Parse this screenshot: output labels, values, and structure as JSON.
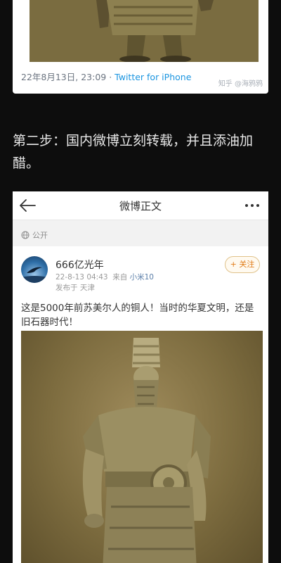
{
  "tweet": {
    "timestamp": "22年8月13日, 23:09",
    "separator": " · ",
    "source": "Twitter for iPhone",
    "watermark": "知乎 @海鸦鸦"
  },
  "narration": {
    "text": "第二步：国内微博立刻转载，并且添油加醋。"
  },
  "weibo": {
    "nav_title": "微博正文",
    "privacy_label": "公开",
    "post": {
      "username": "666亿光年",
      "date": "22-8-13 04:43",
      "source_prefix": "来自",
      "device": "小米10",
      "location": "发布于 天津",
      "follow_label": "+ 关注",
      "text": "这是5000年前苏美尔人的铜人！当时的华夏文明，还是旧石器时代！"
    }
  },
  "colors": {
    "page_bg": "#0d0d0d",
    "twitter_link": "#1b95e0",
    "follow_orange": "#e07b17"
  }
}
